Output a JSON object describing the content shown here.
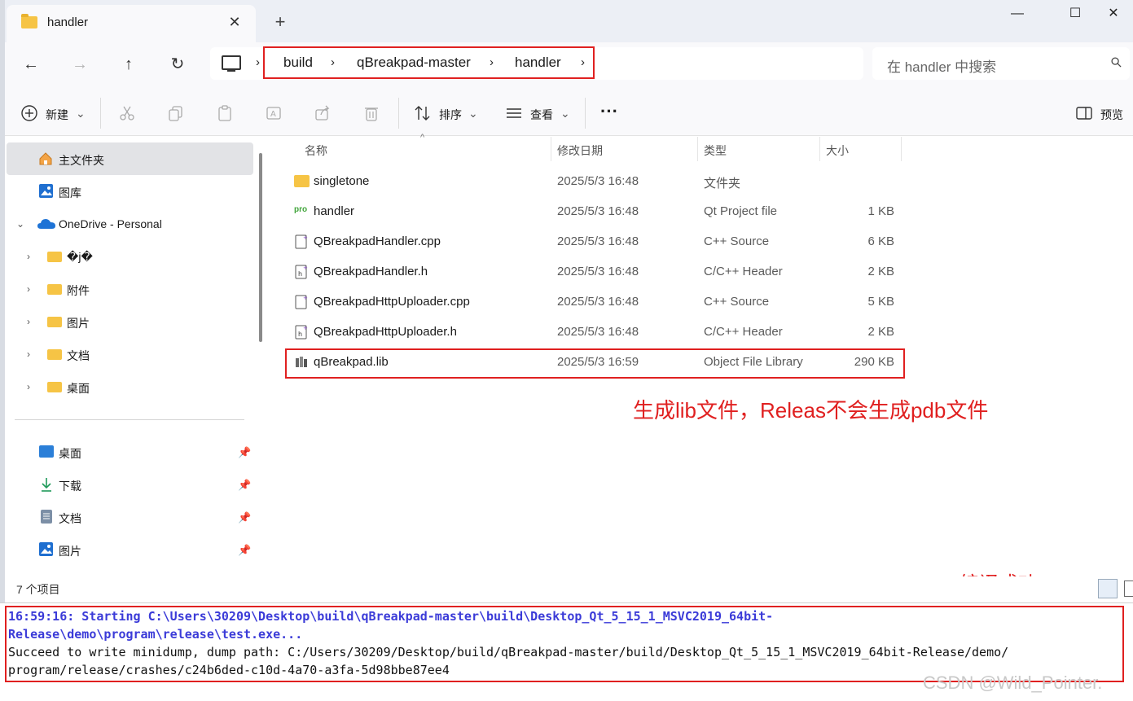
{
  "window": {
    "tab_title": "handler",
    "new_tab_label": "+",
    "minimize_label": "—",
    "maximize_label": "☐",
    "close_label": "✕"
  },
  "address": {
    "breadcrumb": [
      "build",
      "qBreakpad-master",
      "handler"
    ],
    "search_placeholder": "在 handler 中搜索"
  },
  "toolbar": {
    "new_label": "新建",
    "sort_label": "排序",
    "view_label": "查看",
    "more_label": "···",
    "preview_label": "预览"
  },
  "sidebar": {
    "home": "主文件夹",
    "gallery": "图库",
    "onedrive": "OneDrive - Personal",
    "onedrive_folders": [
      "�j�",
      "附件",
      "图片",
      "文档",
      "桌面"
    ],
    "quick_access": [
      "桌面",
      "下载",
      "文档",
      "图片"
    ]
  },
  "columns": {
    "name": "名称",
    "date": "修改日期",
    "type": "类型",
    "size": "大小"
  },
  "files": [
    {
      "name": "singletone",
      "date": "2025/5/3 16:48",
      "type": "文件夹",
      "size": "",
      "icon": "folder-icon"
    },
    {
      "name": "handler",
      "date": "2025/5/3 16:48",
      "type": "Qt Project file",
      "size": "1 KB",
      "icon": "qt-pro-icon"
    },
    {
      "name": "QBreakpadHandler.cpp",
      "date": "2025/5/3 16:48",
      "type": "C++ Source",
      "size": "6 KB",
      "icon": "cpp-file-icon"
    },
    {
      "name": "QBreakpadHandler.h",
      "date": "2025/5/3 16:48",
      "type": "C/C++ Header",
      "size": "2 KB",
      "icon": "header-file-icon"
    },
    {
      "name": "QBreakpadHttpUploader.cpp",
      "date": "2025/5/3 16:48",
      "type": "C++ Source",
      "size": "5 KB",
      "icon": "cpp-file-icon"
    },
    {
      "name": "QBreakpadHttpUploader.h",
      "date": "2025/5/3 16:48",
      "type": "C/C++ Header",
      "size": "2 KB",
      "icon": "header-file-icon"
    },
    {
      "name": "qBreakpad.lib",
      "date": "2025/5/3 16:59",
      "type": "Object File Library",
      "size": "290 KB",
      "icon": "lib-file-icon"
    }
  ],
  "status": {
    "item_count": "7 个项目"
  },
  "annotations": {
    "lib_note": "生成lib文件，Releas不会生成pdb文件",
    "build_note": "编译成功"
  },
  "console": {
    "line1": "16:59:16: Starting C:\\Users\\30209\\Desktop\\build\\qBreakpad-master\\build\\Desktop_Qt_5_15_1_MSVC2019_64bit-",
    "line2": "Release\\demo\\program\\release\\test.exe...",
    "line3": "Succeed to write minidump, dump path: C:/Users/30209/Desktop/build/qBreakpad-master/build/Desktop_Qt_5_15_1_MSVC2019_64bit-Release/demo/",
    "line4": "program/release/crashes/c24b6ded-c10d-4a70-a3fa-5d98bbe87ee4"
  },
  "watermark": "CSDN @Wild_Pointer.",
  "colors": {
    "annotation_red": "#e02020",
    "console_blue": "#3b3bd8",
    "folder_yellow": "#f6c445"
  }
}
